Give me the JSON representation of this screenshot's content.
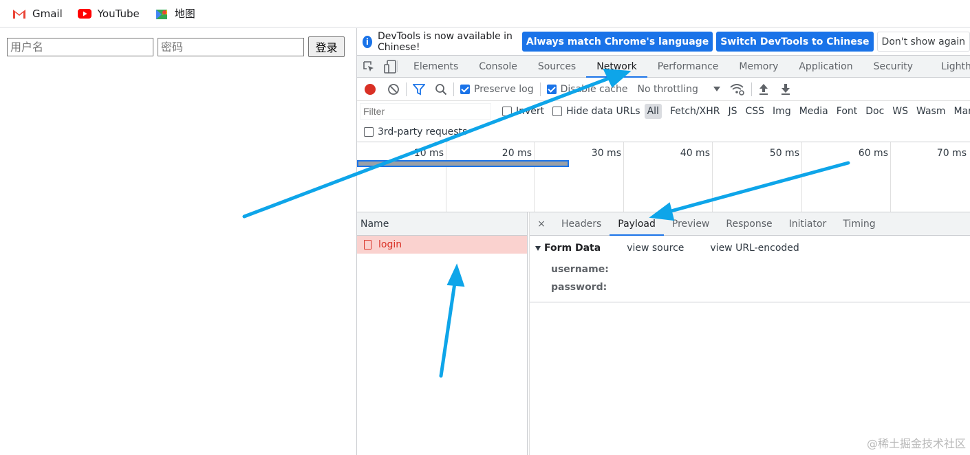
{
  "bookmarks": [
    {
      "label": "Gmail",
      "icon": "gmail-icon"
    },
    {
      "label": "YouTube",
      "icon": "youtube-icon"
    },
    {
      "label": "地图",
      "icon": "maps-icon"
    }
  ],
  "page_form": {
    "username_placeholder": "用户名",
    "password_placeholder": "密码",
    "login_button": "登录"
  },
  "devtools": {
    "infobar": {
      "message": "DevTools is now available in Chinese!",
      "match_language": "Always match Chrome's language",
      "switch_chinese": "Switch DevTools to Chinese",
      "dont_show": "Don't show again"
    },
    "tabs": [
      "Elements",
      "Console",
      "Sources",
      "Network",
      "Performance",
      "Memory",
      "Application",
      "Security",
      "Lighthouse"
    ],
    "active_tab": "Network",
    "toolbar": {
      "preserve_log": "Preserve log",
      "disable_cache": "Disable cache",
      "throttling": "No throttling"
    },
    "filter": {
      "placeholder": "Filter",
      "invert": "Invert",
      "hide_data_urls": "Hide data URLs",
      "types": [
        "All",
        "Fetch/XHR",
        "JS",
        "CSS",
        "Img",
        "Media",
        "Font",
        "Doc",
        "WS",
        "Wasm",
        "Manifest"
      ],
      "third_party": "3rd-party requests"
    },
    "timeline": {
      "ticks": [
        "10 ms",
        "20 ms",
        "30 ms",
        "40 ms",
        "50 ms",
        "60 ms",
        "70 ms"
      ]
    },
    "requests": {
      "name_header": "Name",
      "rows": [
        {
          "name": "login"
        }
      ]
    },
    "detail": {
      "close": "×",
      "tabs": [
        "Headers",
        "Payload",
        "Preview",
        "Response",
        "Initiator",
        "Timing"
      ],
      "active_tab": "Payload",
      "form_data_title": "Form Data",
      "view_source": "view source",
      "view_url_encoded": "view URL-encoded",
      "fields": [
        {
          "key": "username:"
        },
        {
          "key": "password:"
        }
      ]
    }
  },
  "watermark": "@稀土掘金技术社区",
  "colors": {
    "accent": "#1a73e8",
    "arrow": "#0ea5e9",
    "error_row": "#fad2cf",
    "error_text": "#d93025"
  }
}
